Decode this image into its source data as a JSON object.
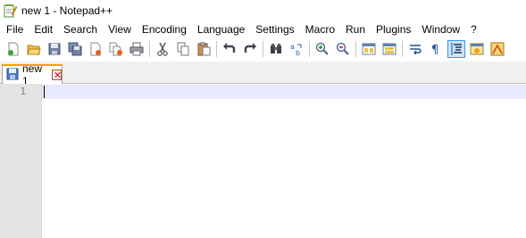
{
  "window": {
    "title": "new 1 - Notepad++",
    "icon": "notepad-pp-icon"
  },
  "menu": [
    {
      "label": "File"
    },
    {
      "label": "Edit"
    },
    {
      "label": "Search"
    },
    {
      "label": "View"
    },
    {
      "label": "Encoding"
    },
    {
      "label": "Language"
    },
    {
      "label": "Settings"
    },
    {
      "label": "Macro"
    },
    {
      "label": "Run"
    },
    {
      "label": "Plugins"
    },
    {
      "label": "Window"
    },
    {
      "label": "?"
    }
  ],
  "toolbar": {
    "icons": [
      "new-file-icon",
      "open-file-icon",
      "save-icon",
      "save-all-icon",
      "close-icon",
      "close-all-icon",
      "print-icon",
      "cut-icon",
      "copy-icon",
      "paste-icon",
      "undo-icon",
      "redo-icon",
      "find-icon",
      "replace-icon",
      "zoom-in-icon",
      "zoom-out-icon",
      "sync-vertical-icon",
      "sync-horizontal-icon",
      "word-wrap-icon",
      "show-all-chars-icon",
      "indent-guide-icon",
      "document-map-icon",
      "function-list-icon"
    ],
    "active": "indent-guide-icon"
  },
  "tabs": [
    {
      "label": "new 1",
      "active": true,
      "accent": "#f4a000"
    }
  ],
  "editor": {
    "line_numbers": [
      "1"
    ],
    "current_line_color": "#e8e8ff",
    "gutter_color": "#e4e4e4"
  }
}
